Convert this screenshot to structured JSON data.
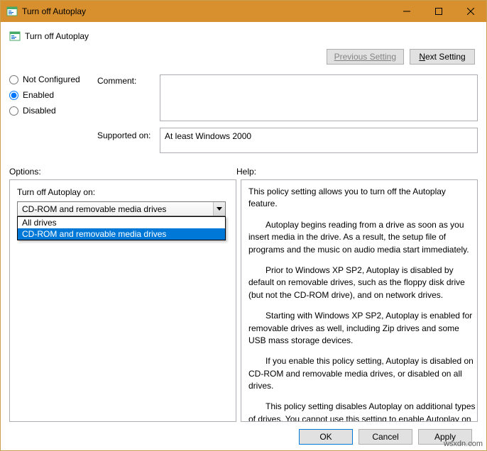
{
  "window": {
    "title": "Turn off Autoplay"
  },
  "header": {
    "title": "Turn off Autoplay"
  },
  "nav": {
    "previous": "Previous Setting",
    "next_prefix": "N",
    "next_rest": "ext Setting"
  },
  "config": {
    "not_configured": "Not Configured",
    "enabled": "Enabled",
    "disabled": "Disabled",
    "comment_label": "Comment:",
    "comment_value": "",
    "supported_label": "Supported on:",
    "supported_value": "At least Windows 2000"
  },
  "labels": {
    "options": "Options:",
    "help": "Help:"
  },
  "options": {
    "field_label": "Turn off Autoplay on:",
    "selected": "CD-ROM and removable media drives",
    "items": [
      "All drives",
      "CD-ROM and removable media drives"
    ]
  },
  "help": {
    "p1": "This policy setting allows you to turn off the Autoplay feature.",
    "p2": "Autoplay begins reading from a drive as soon as you insert media in the drive. As a result, the setup file of programs and the music on audio media start immediately.",
    "p3": "Prior to Windows XP SP2, Autoplay is disabled by default on removable drives, such as the floppy disk drive (but not the CD-ROM drive), and on network drives.",
    "p4": "Starting with Windows XP SP2, Autoplay is enabled for removable drives as well, including Zip drives and some USB mass storage devices.",
    "p5": "If you enable this policy setting, Autoplay is disabled on CD-ROM and removable media drives, or disabled on all drives.",
    "p6": "This policy setting disables Autoplay on additional types of drives. You cannot use this setting to enable Autoplay on drives on which it is disabled by default."
  },
  "footer": {
    "ok": "OK",
    "cancel": "Cancel",
    "apply": "Apply"
  },
  "watermark": "wsxdn.com"
}
